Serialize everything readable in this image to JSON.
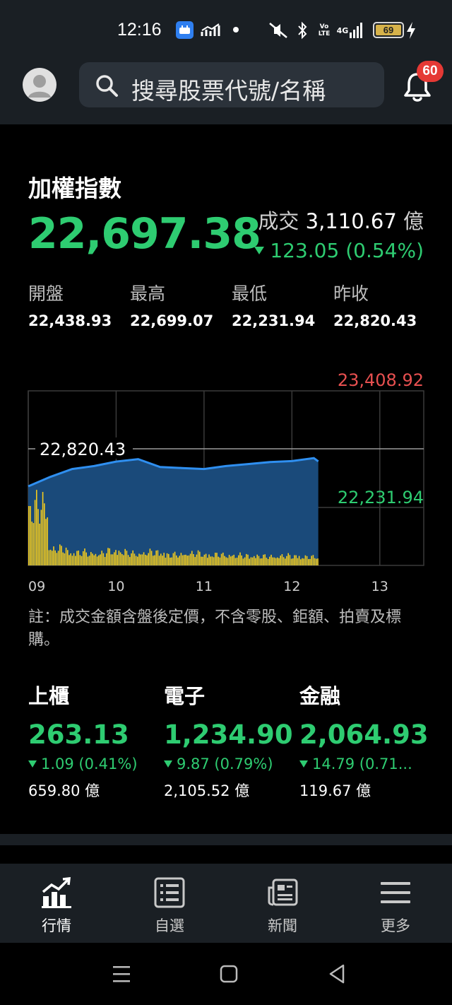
{
  "status_bar": {
    "time": "12:16",
    "battery": "69",
    "icons": [
      "app-notification-icon",
      "signal-chart-icon",
      "dot-icon",
      "mute-icon",
      "bluetooth-icon",
      "volte-icon",
      "4g-signal-icon",
      "battery-icon",
      "charging-bolt-icon"
    ],
    "volte_top": "Vo",
    "volte_bottom": "LTE",
    "network": "4G"
  },
  "header": {
    "search_placeholder": "搜尋股票代號/名稱",
    "notification_count": "60"
  },
  "index": {
    "name": "加權指數",
    "value": "22,697.38",
    "volume_label": "成交",
    "volume_value": "3,110.67",
    "volume_unit": "億",
    "change": "123.05 (0.54%)",
    "change_direction": "down",
    "stats": [
      {
        "label": "開盤",
        "value": "22,438.93"
      },
      {
        "label": "最高",
        "value": "22,699.07"
      },
      {
        "label": "最低",
        "value": "22,231.94"
      },
      {
        "label": "昨收",
        "value": "22,820.43"
      }
    ]
  },
  "chart_data": {
    "type": "area",
    "y_max_label": "23,408.92",
    "y_min_label": "22,231.94",
    "reference_label": "22,820.43",
    "reference_value": 22820.43,
    "y_top": 23408.92,
    "y_bottom": 22231.94,
    "x_ticks": [
      "09",
      "10",
      "11",
      "12",
      "13"
    ],
    "x_hours": [
      9,
      9.25,
      9.5,
      9.75,
      10,
      10.25,
      10.5,
      10.75,
      11,
      11.25,
      11.5,
      11.75,
      12,
      12.25,
      12.3
    ],
    "prices": [
      22445,
      22540,
      22620,
      22650,
      22695,
      22720,
      22640,
      22630,
      22620,
      22650,
      22670,
      22690,
      22700,
      22730,
      22697
    ],
    "volume_relative": [
      1.0,
      0.28,
      0.22,
      0.2,
      0.24,
      0.2,
      0.22,
      0.18,
      0.2,
      0.18,
      0.17,
      0.16,
      0.15,
      0.16,
      0.14
    ],
    "price_color": "#2f8ff0",
    "area_color": "#1a4a7a",
    "volume_color": "#f5cc1c",
    "max_label_color": "#e85050",
    "min_label_color": "#2ecc71",
    "grid": true
  },
  "note": "註：成交金額含盤後定價，不含零股、鉅額、拍賣及標購。",
  "sub_indices": [
    {
      "name": "上櫃",
      "value": "263.13",
      "change": "1.09 (0.41%)",
      "volume": "659.80 億"
    },
    {
      "name": "電子",
      "value": "1,234.90",
      "change": "9.87 (0.79%)",
      "volume": "2,105.52 億"
    },
    {
      "name": "金融",
      "value": "2,064.93",
      "change": "14.79 (0.71...",
      "volume": "119.67 億"
    }
  ],
  "bottom_nav": [
    {
      "label": "行情",
      "icon": "market-chart-icon",
      "active": true
    },
    {
      "label": "自選",
      "icon": "watchlist-icon",
      "active": false
    },
    {
      "label": "新聞",
      "icon": "news-icon",
      "active": false
    },
    {
      "label": "更多",
      "icon": "menu-icon",
      "active": false
    }
  ],
  "colors": {
    "up_green": "#2ecc71",
    "down_red": "#e85050",
    "background": "#000000",
    "bar": "#1a1f24"
  }
}
